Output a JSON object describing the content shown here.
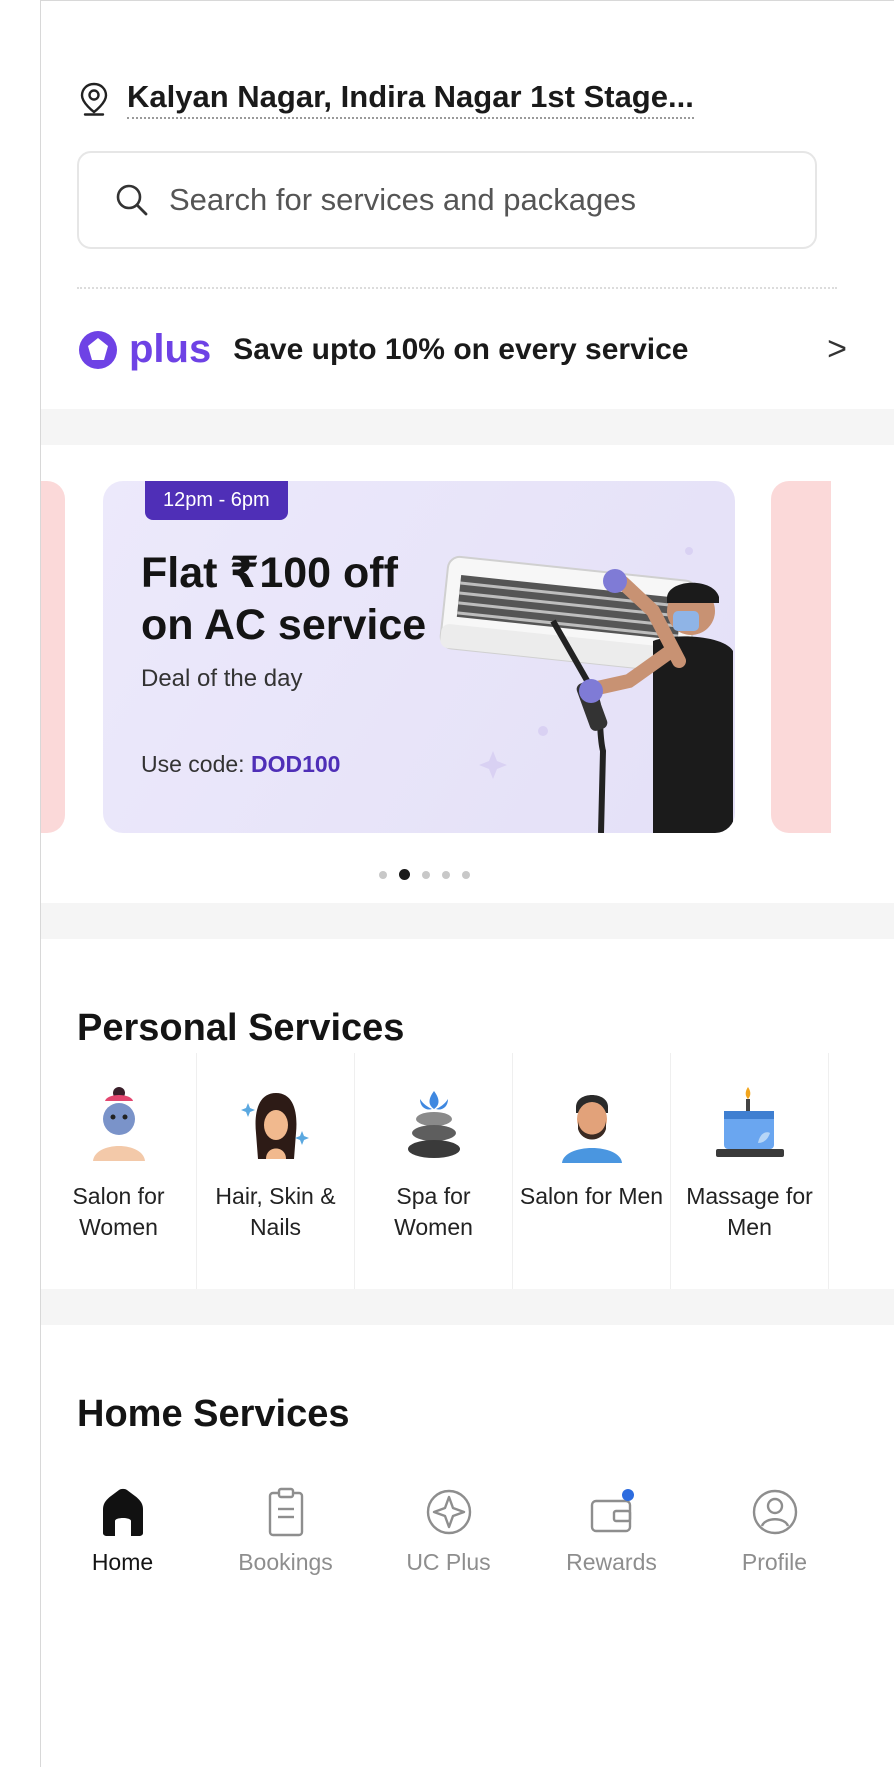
{
  "header": {
    "location": "Kalyan Nagar, Indira Nagar 1st Stage...",
    "location_icon": "location-pin-icon"
  },
  "search": {
    "placeholder": "Search for services and packages",
    "icon": "search-icon"
  },
  "plus_strip": {
    "brand": "plus",
    "tagline": "Save upto 10% on every service",
    "chevron": ">",
    "accent": "#6e42e5"
  },
  "banner": {
    "badge": "12pm - 6pm",
    "headline": "Flat ₹100 off on AC service",
    "subtitle": "Deal of the day",
    "code_prefix": "Use code: ",
    "code": "DOD100",
    "badge_color": "#4f2fb7",
    "dots_total": 5,
    "dots_active_index": 1
  },
  "personal_services": {
    "title": "Personal Services",
    "items": [
      {
        "label": "Salon for Women",
        "icon": "salon-women-icon"
      },
      {
        "label": "Hair, Skin & Nails",
        "icon": "hair-skin-nails-icon"
      },
      {
        "label": "Spa for Women",
        "icon": "spa-stones-icon"
      },
      {
        "label": "Salon for Men",
        "icon": "salon-men-icon"
      },
      {
        "label": "Massage for Men",
        "icon": "massage-candle-icon"
      }
    ]
  },
  "home_services": {
    "title": "Home Services"
  },
  "bottom_nav": {
    "items": [
      {
        "label": "Home",
        "icon": "home-icon",
        "active": true
      },
      {
        "label": "Bookings",
        "icon": "clipboard-icon",
        "active": false
      },
      {
        "label": "UC Plus",
        "icon": "uc-plus-icon",
        "active": false
      },
      {
        "label": "Rewards",
        "icon": "wallet-icon",
        "active": false
      },
      {
        "label": "Profile",
        "icon": "profile-icon",
        "active": false
      }
    ]
  }
}
